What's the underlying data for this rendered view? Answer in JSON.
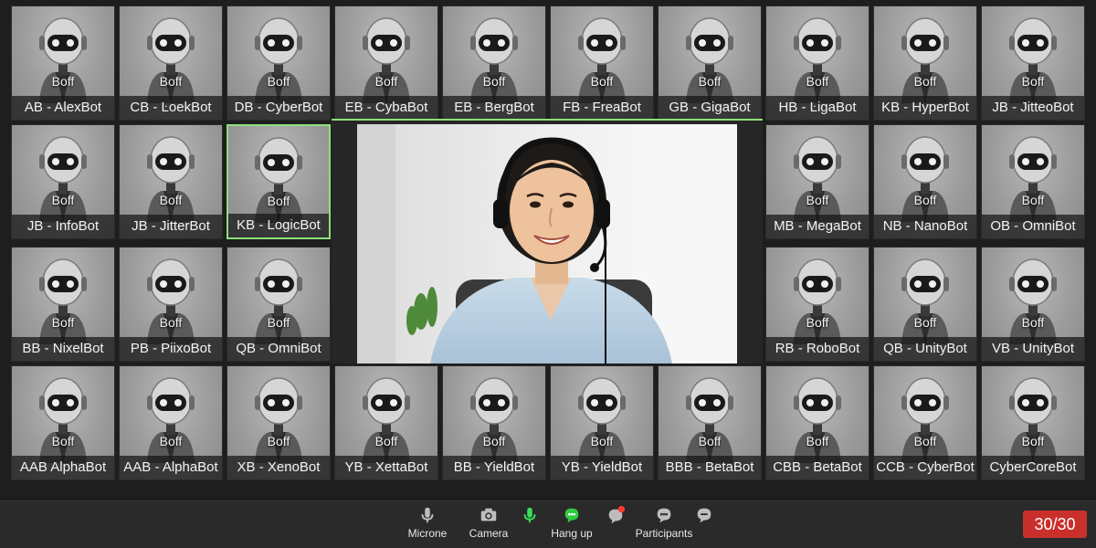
{
  "participants": [
    {
      "name": "AB - AlexBot",
      "badge": "Boff"
    },
    {
      "name": "CB - ĿoekBot",
      "badge": "Boff"
    },
    {
      "name": "DB - CyberBot",
      "badge": "Boff"
    },
    {
      "name": "EB - CybaBot",
      "badge": "Boff"
    },
    {
      "name": "EB - BergBot",
      "badge": "Boff"
    },
    {
      "name": "FB - FreaBot",
      "badge": "Boff"
    },
    {
      "name": "GB - GigaBot",
      "badge": "Boff"
    },
    {
      "name": "HB - ĿigaBot",
      "badge": "Boff"
    },
    {
      "name": "KB - HyperBot",
      "badge": "Boff"
    },
    {
      "name": "JB - JitteoBot",
      "badge": "Boff"
    },
    {
      "name": "JB - InfoBot",
      "badge": "Boff"
    },
    {
      "name": "JB - JitterBot",
      "badge": "Boff"
    },
    {
      "name": "KB - LogicBot",
      "badge": "Boff",
      "active": true
    },
    {
      "name": "MB - MegaBot",
      "badge": "Boff"
    },
    {
      "name": "NB - NanoBot",
      "badge": "Boff"
    },
    {
      "name": "OB - OmniBot",
      "badge": "Boff"
    },
    {
      "name": "BB - NixelBot",
      "badge": "Boff"
    },
    {
      "name": "PB - PiixoBot",
      "badge": "Boff"
    },
    {
      "name": "QB - OmniBot",
      "badge": "Boff"
    },
    {
      "name": "RB - RoboBot",
      "badge": "Boff"
    },
    {
      "name": "QB - UnityBot",
      "badge": "Boff"
    },
    {
      "name": "VB - UnityBot",
      "badge": "Boff"
    },
    {
      "name": "AAB AlphaBot",
      "badge": "Boff"
    },
    {
      "name": "AAB - AlphaBot",
      "badge": "Boff"
    },
    {
      "name": "XB - XenoBot",
      "badge": "Boff"
    },
    {
      "name": "YB - XettaBot",
      "badge": "Boff"
    },
    {
      "name": "BB - YieldBot",
      "badge": "Boff"
    },
    {
      "name": "YB - YieldBot",
      "badge": "Boff"
    },
    {
      "name": "BBB - BetaBot",
      "badge": "Boff"
    },
    {
      "name": "CBB - BetaBot",
      "badge": "Boff"
    },
    {
      "name": "CCB - CyberBot",
      "badge": "Boff"
    },
    {
      "name": "CyberCoreBot",
      "badge": "Boff"
    }
  ],
  "main_video": {
    "icon": "speaker-video"
  },
  "toolbar": {
    "buttons": [
      {
        "label": "Microne",
        "icon": "microphone-icon"
      },
      {
        "label": "Camera",
        "icon": "camera-icon"
      },
      {
        "label": "",
        "icon": "microphone-active-icon"
      },
      {
        "label": "Hang up",
        "icon": "chat-green-icon"
      },
      {
        "label": "",
        "icon": "chat-notification-icon"
      },
      {
        "label": "Participants",
        "icon": "participants-icon"
      },
      {
        "label": "",
        "icon": "chat-icon"
      }
    ],
    "count": "30/30"
  },
  "colors": {
    "active_border": "#8ee07a",
    "count_badge": "#c9302c",
    "hang_up_green": "#2ecc40",
    "mic_active_green": "#3ddc5a",
    "notification_red": "#ff3b30"
  }
}
